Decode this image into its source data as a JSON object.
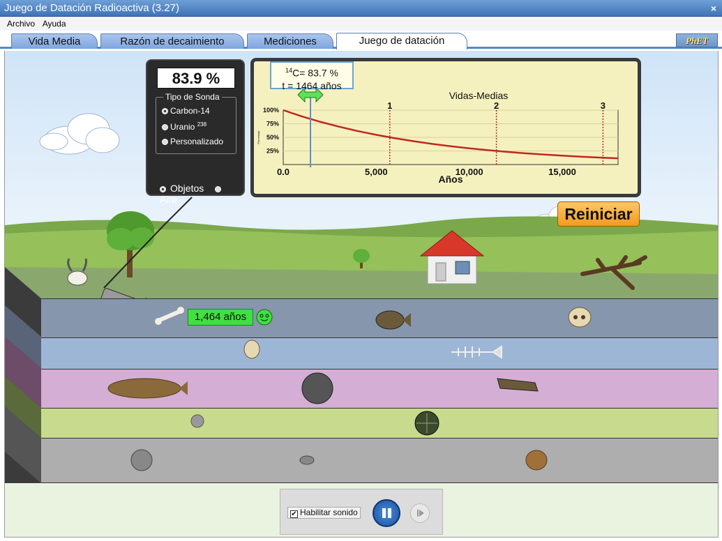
{
  "window": {
    "title": "Juego de Datación Radioactiva (3.27)",
    "close_symbol": "×"
  },
  "menu": {
    "items": [
      "Archivo",
      "Ayuda"
    ]
  },
  "tabs": [
    {
      "label": "Vida Media"
    },
    {
      "label": "Razón de decaimiento"
    },
    {
      "label": "Mediciones"
    },
    {
      "label": "Juego de datación",
      "active": true
    }
  ],
  "logo": {
    "text": "PhET"
  },
  "probe": {
    "percent": "83.9 %",
    "group_label": "Tipo de Sonda",
    "options": [
      {
        "label": "Carbon-14",
        "selected": true
      },
      {
        "label": "Uranio",
        "sup": "238",
        "selected": false
      },
      {
        "label": "Personalizado",
        "selected": false
      }
    ],
    "targets": [
      {
        "label": "Objetos",
        "selected": true
      },
      {
        "label": "Aire",
        "selected": false
      }
    ]
  },
  "readout": {
    "isotope_sup": "14",
    "line1": "C= 83.7 %",
    "line2": "t = 1464 años"
  },
  "chart_data": {
    "type": "line",
    "title": "Vidas-Medias",
    "xlabel": "Años",
    "ylabel": "Porcentaje",
    "xlim": [
      0,
      18000
    ],
    "ylim": [
      0,
      100
    ],
    "x_ticks": [
      "0.0",
      "5,000",
      "10,000",
      "15,000"
    ],
    "x_tick_values": [
      0,
      5000,
      10000,
      15000
    ],
    "y_ticks": [
      "100%",
      "75%",
      "50%",
      "25%"
    ],
    "y_tick_values": [
      100,
      75,
      50,
      25
    ],
    "half_life_markers": [
      {
        "label": "1",
        "x": 5730
      },
      {
        "label": "2",
        "x": 11460
      },
      {
        "label": "3",
        "x": 17190
      }
    ],
    "current_time": 1464,
    "half_life": 5730,
    "series": [
      {
        "x": [
          0,
          1000,
          2000,
          3000,
          4000,
          5000,
          6000,
          7000,
          8000,
          9000,
          10000,
          11000,
          12000,
          13000,
          14000,
          15000,
          16000,
          17000,
          18000
        ],
        "values": [
          100,
          88.6,
          78.5,
          69.6,
          61.6,
          54.6,
          48.4,
          42.9,
          38.0,
          33.7,
          29.8,
          26.4,
          23.4,
          20.7,
          18.4,
          16.3,
          14.4,
          12.8,
          11.3
        ]
      }
    ],
    "colors": {
      "curve": "#c0281e",
      "marker_line": "#c0281e",
      "time_line": "#5a8fd0"
    }
  },
  "reset_button": {
    "label": "Reiniciar"
  },
  "age_tag": {
    "label": "1,464 años"
  },
  "controls": {
    "sound_label": "Habilitar sonido",
    "sound_checked": "✔"
  },
  "colors": {
    "strata": [
      "#8696ac",
      "#9eb6d6",
      "#d4aed4",
      "#c8da8e",
      "#aeaeae"
    ]
  }
}
